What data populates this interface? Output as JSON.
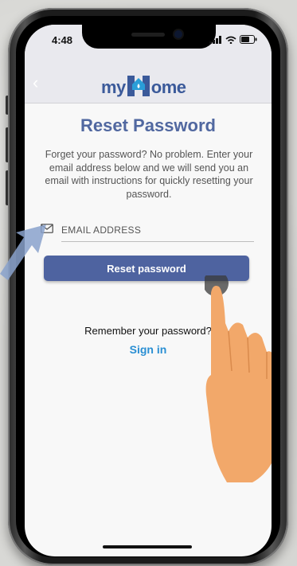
{
  "status_bar": {
    "time": "4:48"
  },
  "header": {
    "back_icon": "chevron-left-icon",
    "logo_prefix": "my",
    "logo_suffix": "ome"
  },
  "page": {
    "title": "Reset Password",
    "description": "Forget your password? No problem. Enter your email address below and we will send you an email with instructions for quickly resetting your password."
  },
  "form": {
    "email_placeholder": "EMAIL ADDRESS",
    "email_icon": "mail-icon",
    "reset_button": "Reset password"
  },
  "footer": {
    "remember_text": "Remember your password?",
    "signin_link": "Sign in"
  },
  "colors": {
    "accent": "#4e63a0",
    "link": "#2a8fd3",
    "title": "#5168a0"
  }
}
